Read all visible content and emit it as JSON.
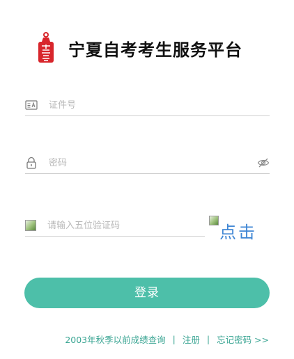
{
  "header": {
    "logo_icon": "seal-stamp-icon",
    "title": "宁夏自考考生服务平台"
  },
  "form": {
    "id_field": {
      "icon": "id-card-icon",
      "placeholder": "证件号",
      "value": ""
    },
    "password_field": {
      "icon": "lock-icon",
      "placeholder": "密码",
      "value": "",
      "toggle_icon": "eye-off-icon"
    },
    "captcha_field": {
      "icon": "broken-image-icon",
      "placeholder": "请输入五位验证码",
      "value": ""
    },
    "captcha_image_text": "点击"
  },
  "login_button": "登录",
  "links": {
    "scores": "2003年秋季以前成绩查询",
    "separator": "|",
    "register": "注册",
    "forgot": "忘记密码 >>"
  },
  "colors": {
    "accent": "#4dbfa9",
    "link": "#3aa593",
    "captcha_text": "#3f86d4",
    "logo_red": "#d8262c"
  }
}
